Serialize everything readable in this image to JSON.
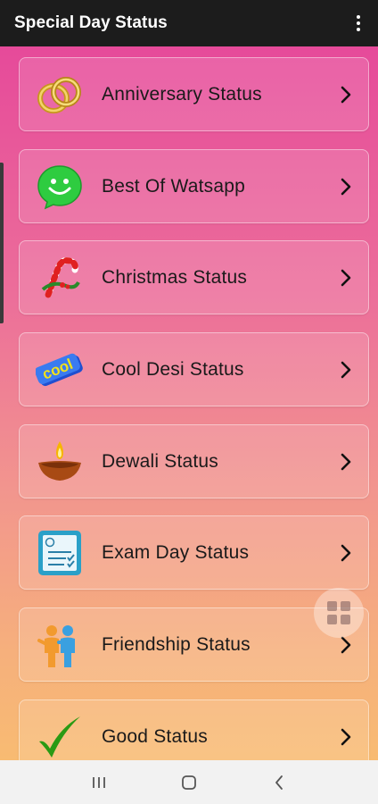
{
  "app": {
    "title": "Special Day Status"
  },
  "items": [
    {
      "label": "Anniversary Status",
      "icon": "rings-icon"
    },
    {
      "label": "Best Of Watsapp",
      "icon": "whatsapp-smile-icon"
    },
    {
      "label": "Christmas Status",
      "icon": "candy-cane-icon"
    },
    {
      "label": "Cool Desi Status",
      "icon": "cool-text-icon"
    },
    {
      "label": "Dewali Status",
      "icon": "diya-lamp-icon"
    },
    {
      "label": "Exam Day Status",
      "icon": "checklist-icon"
    },
    {
      "label": "Friendship Status",
      "icon": "friends-icon"
    },
    {
      "label": "Good Status",
      "icon": "checkmark-icon"
    }
  ],
  "colors": {
    "appbar": "#1c1c1c",
    "gradient_top": "#e64a9a",
    "gradient_bottom": "#f8bb72"
  }
}
